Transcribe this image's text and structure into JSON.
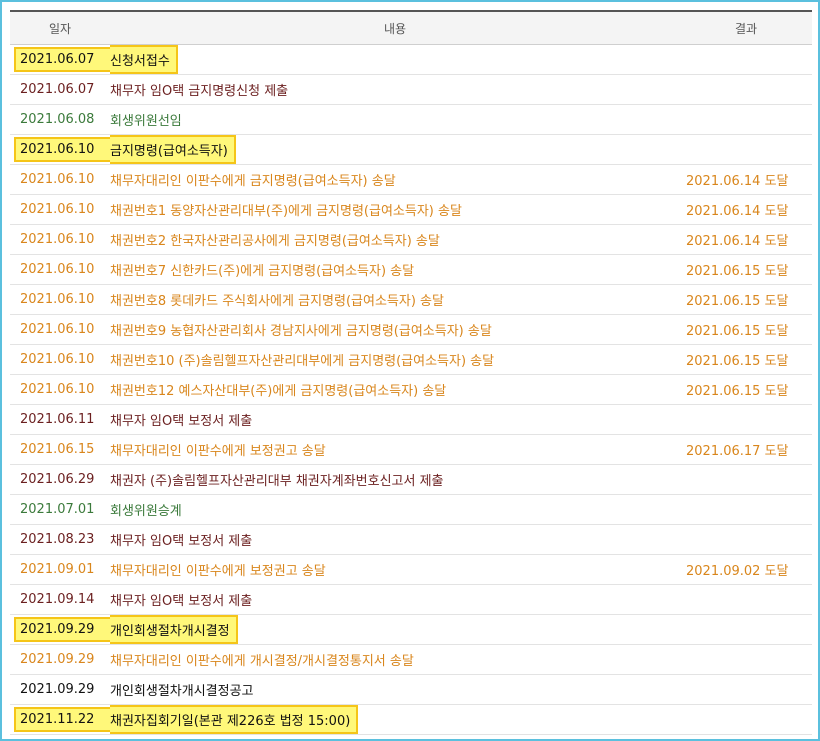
{
  "headers": {
    "date": "일자",
    "content": "내용",
    "result": "결과"
  },
  "rows": [
    {
      "date": "2021.06.07",
      "content": "신청서접수",
      "result": "",
      "color": "black",
      "highlight": true
    },
    {
      "date": "2021.06.07",
      "content": "채무자 임O택 금지명령신청 제출",
      "result": "",
      "color": "dark",
      "highlight": false
    },
    {
      "date": "2021.06.08",
      "content": "회생위원선임",
      "result": "",
      "color": "green",
      "highlight": false
    },
    {
      "date": "2021.06.10",
      "content": "금지명령(급여소득자)",
      "result": "",
      "color": "black",
      "highlight": true
    },
    {
      "date": "2021.06.10",
      "content": "채무자대리인 이판수에게 금지명령(급여소득자) 송달",
      "result": "2021.06.14 도달",
      "color": "orange",
      "highlight": false
    },
    {
      "date": "2021.06.10",
      "content": "채권번호1 동양자산관리대부(주)에게 금지명령(급여소득자) 송달",
      "result": "2021.06.14 도달",
      "color": "orange",
      "highlight": false
    },
    {
      "date": "2021.06.10",
      "content": "채권번호2 한국자산관리공사에게 금지명령(급여소득자) 송달",
      "result": "2021.06.14 도달",
      "color": "orange",
      "highlight": false
    },
    {
      "date": "2021.06.10",
      "content": "채권번호7 신한카드(주)에게 금지명령(급여소득자) 송달",
      "result": "2021.06.15 도달",
      "color": "orange",
      "highlight": false
    },
    {
      "date": "2021.06.10",
      "content": "채권번호8 롯데카드 주식회사에게 금지명령(급여소득자) 송달",
      "result": "2021.06.15 도달",
      "color": "orange",
      "highlight": false
    },
    {
      "date": "2021.06.10",
      "content": "채권번호9 농협자산관리회사 경남지사에게 금지명령(급여소득자) 송달",
      "result": "2021.06.15 도달",
      "color": "orange",
      "highlight": false
    },
    {
      "date": "2021.06.10",
      "content": "채권번호10 (주)솔림헬프자산관리대부에게 금지명령(급여소득자) 송달",
      "result": "2021.06.15 도달",
      "color": "orange",
      "highlight": false
    },
    {
      "date": "2021.06.10",
      "content": "채권번호12 예스자산대부(주)에게 금지명령(급여소득자) 송달",
      "result": "2021.06.15 도달",
      "color": "orange",
      "highlight": false
    },
    {
      "date": "2021.06.11",
      "content": "채무자 임O택 보정서 제출",
      "result": "",
      "color": "dark",
      "highlight": false
    },
    {
      "date": "2021.06.15",
      "content": "채무자대리인 이판수에게 보정권고 송달",
      "result": "2021.06.17 도달",
      "color": "orange",
      "highlight": false
    },
    {
      "date": "2021.06.29",
      "content": "채권자 (주)솔림헬프자산관리대부 채권자계좌번호신고서 제출",
      "result": "",
      "color": "dark",
      "highlight": false
    },
    {
      "date": "2021.07.01",
      "content": "회생위원승계",
      "result": "",
      "color": "green",
      "highlight": false
    },
    {
      "date": "2021.08.23",
      "content": "채무자 임O택 보정서 제출",
      "result": "",
      "color": "dark",
      "highlight": false
    },
    {
      "date": "2021.09.01",
      "content": "채무자대리인 이판수에게 보정권고 송달",
      "result": "2021.09.02 도달",
      "color": "orange",
      "highlight": false
    },
    {
      "date": "2021.09.14",
      "content": "채무자 임O택 보정서 제출",
      "result": "",
      "color": "dark",
      "highlight": false
    },
    {
      "date": "2021.09.29",
      "content": "개인회생절차개시결정",
      "result": "",
      "color": "black",
      "highlight": true
    },
    {
      "date": "2021.09.29",
      "content": "채무자대리인 이판수에게 개시결정/개시결정통지서 송달",
      "result": "",
      "color": "orange",
      "highlight": false
    },
    {
      "date": "2021.09.29",
      "content": "개인회생절차개시결정공고",
      "result": "",
      "color": "black",
      "highlight": false
    },
    {
      "date": "2021.11.22",
      "content": "채권자집회기일(본관 제226호 법정 15:00)",
      "result": "",
      "color": "black",
      "highlight": true
    }
  ]
}
